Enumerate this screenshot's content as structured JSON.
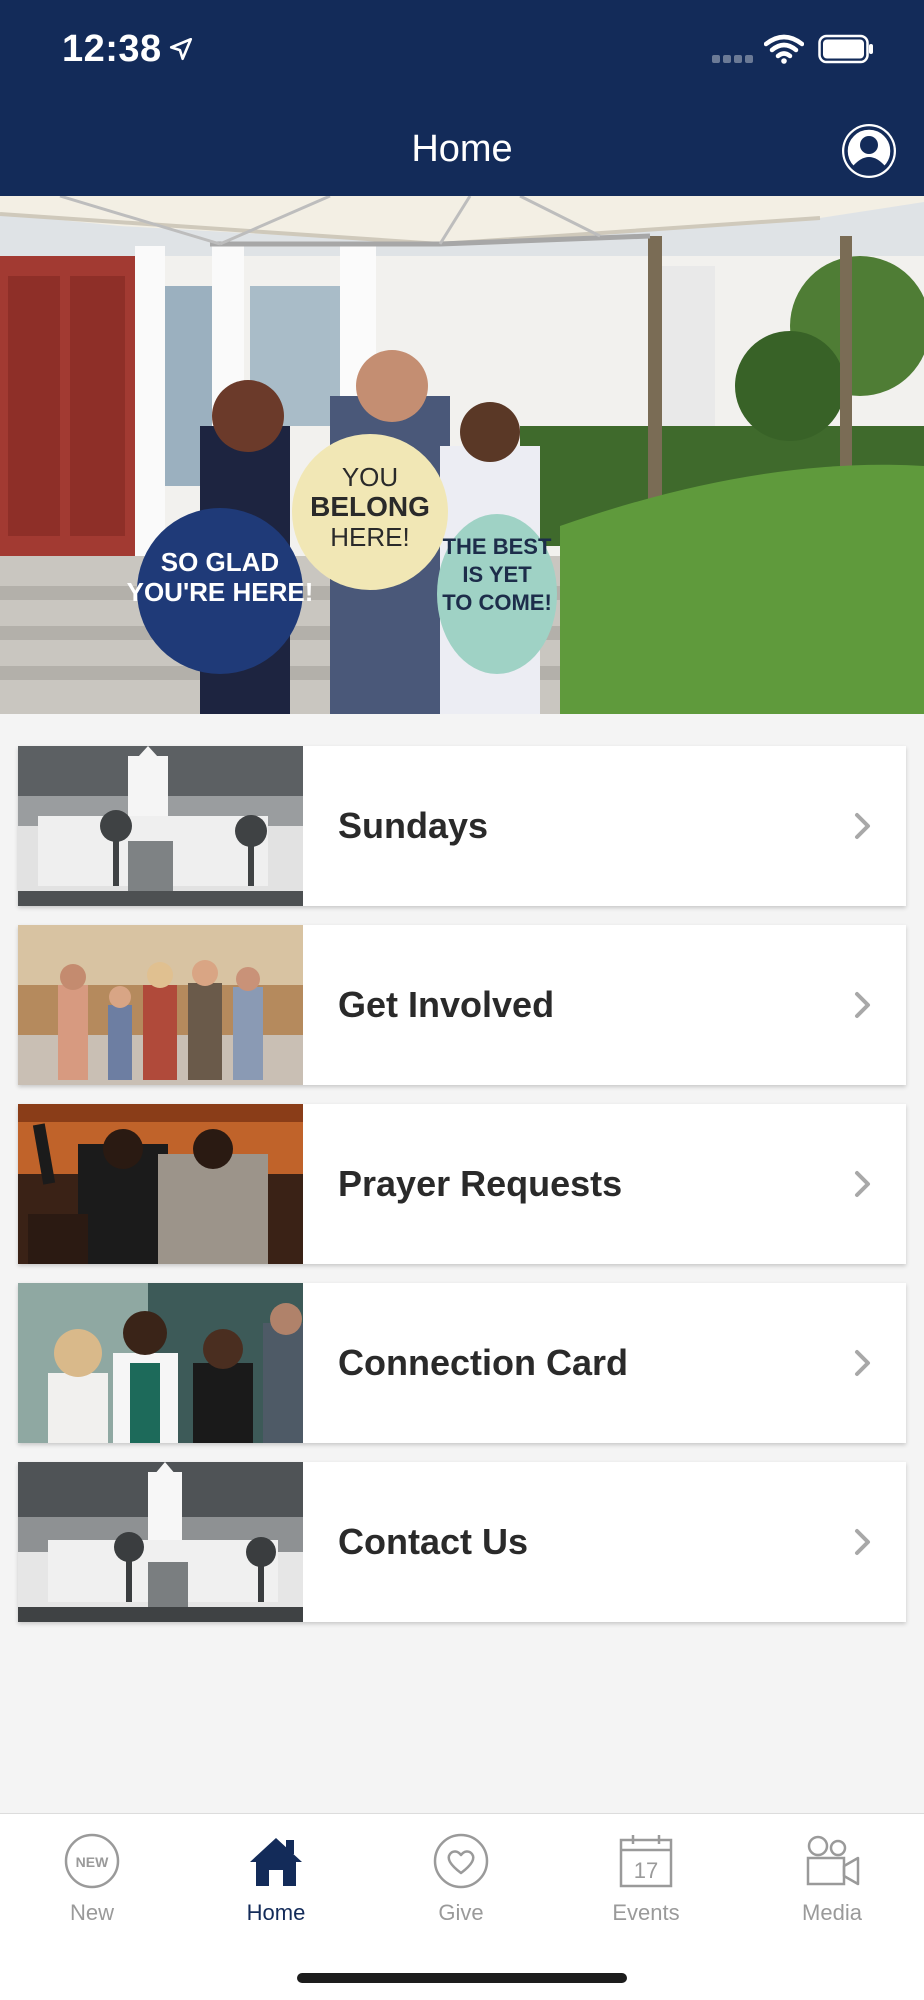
{
  "status_bar": {
    "time": "12:38"
  },
  "header": {
    "title": "Home"
  },
  "hero": {
    "signs": [
      "SO GLAD YOU'RE HERE!",
      "YOU BELONG HERE!",
      "THE BEST IS YET TO COME!"
    ]
  },
  "menu": {
    "items": [
      {
        "label": "Sundays",
        "thumbnail": "church-building-photo"
      },
      {
        "label": "Get Involved",
        "thumbnail": "lobby-people-photo"
      },
      {
        "label": "Prayer Requests",
        "thumbnail": "worship-prayer-photo"
      },
      {
        "label": "Connection Card",
        "thumbnail": "group-conversation-photo"
      },
      {
        "label": "Contact Us",
        "thumbnail": "church-building-photo"
      }
    ]
  },
  "tabbar": {
    "active": "Home",
    "tabs": [
      {
        "label": "New",
        "icon": "new-badge-icon",
        "badge": "NEW"
      },
      {
        "label": "Home",
        "icon": "house-icon"
      },
      {
        "label": "Give",
        "icon": "heart-circle-icon"
      },
      {
        "label": "Events",
        "icon": "calendar-icon",
        "day": "17"
      },
      {
        "label": "Media",
        "icon": "video-camera-icon"
      }
    ]
  },
  "colors": {
    "brand_navy": "#132b59",
    "tab_inactive": "#9a9a9a",
    "background": "#f4f4f4"
  }
}
